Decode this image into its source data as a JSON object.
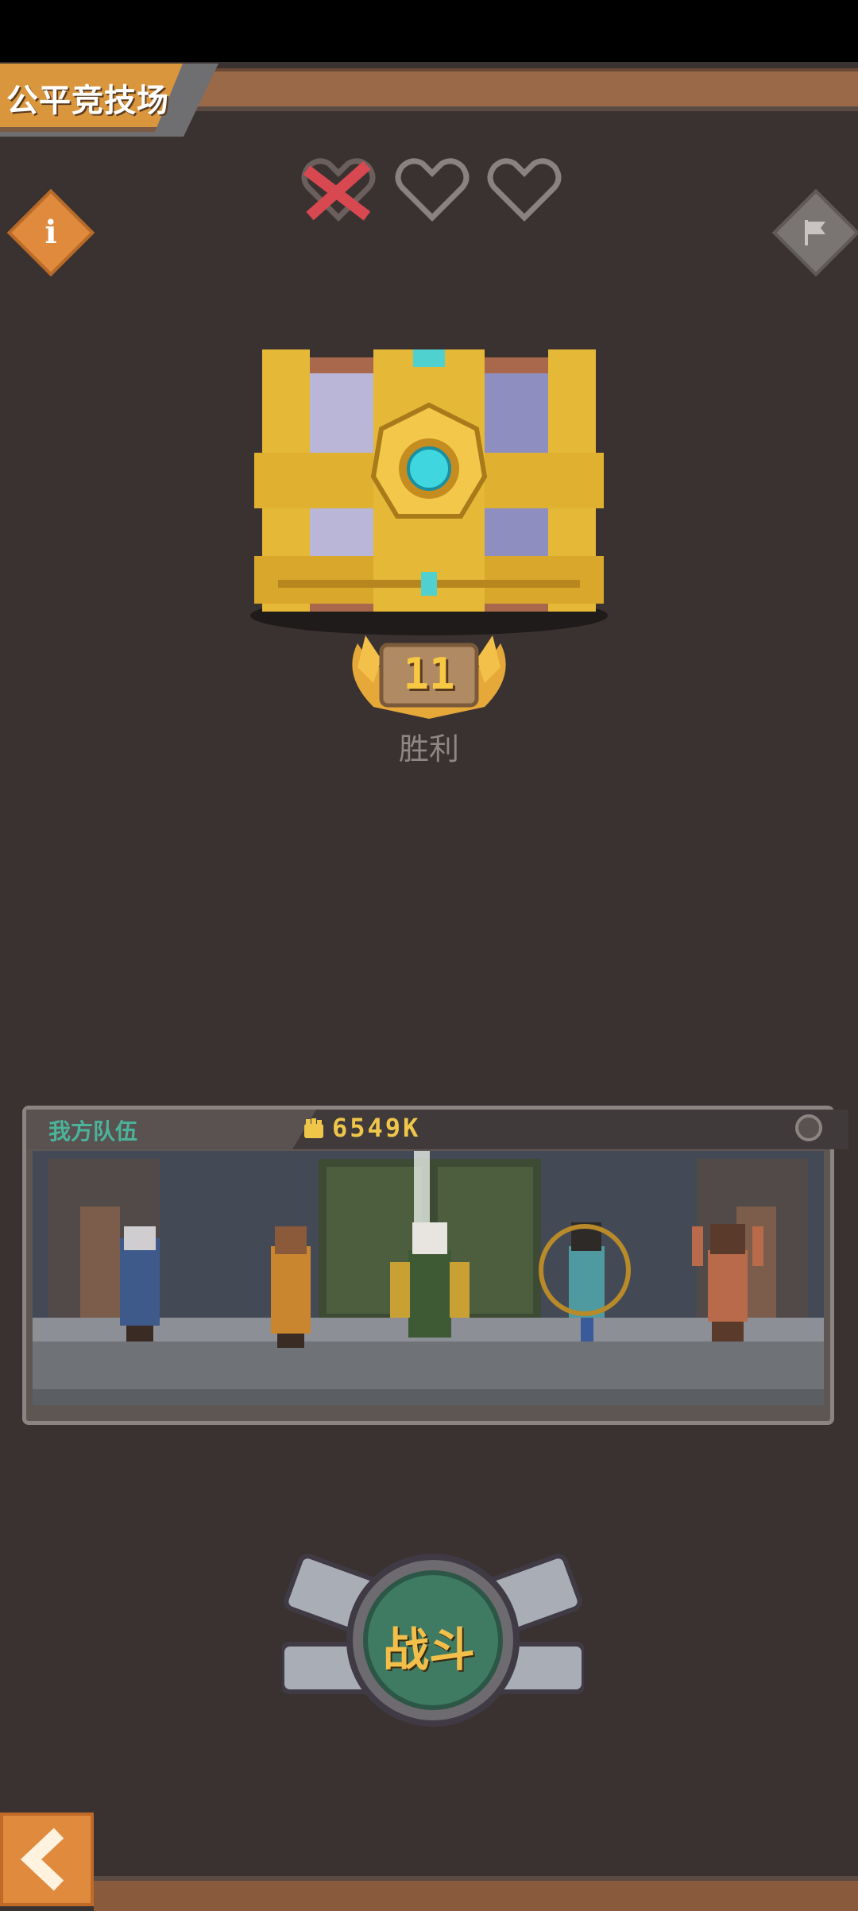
{
  "header": {
    "title": "公平竞技场"
  },
  "lives": {
    "lost": 1,
    "remaining": 2,
    "icons": [
      "heart-crossed-icon",
      "heart-outline-icon",
      "heart-outline-icon"
    ]
  },
  "buttons": {
    "info_icon": "info-icon",
    "report_icon": "flag-icon",
    "back_icon": "chevron-left-icon"
  },
  "reward": {
    "win_count": "11",
    "win_label": "胜利"
  },
  "team": {
    "label": "我方队伍",
    "power": "6549K"
  },
  "fight": {
    "label": "战斗"
  },
  "colors": {
    "background": "#3a3230",
    "accent_orange": "#e08a3e",
    "gold": "#f2bf4a",
    "team_label": "#4bb39a",
    "lost_life": "#d84850"
  }
}
